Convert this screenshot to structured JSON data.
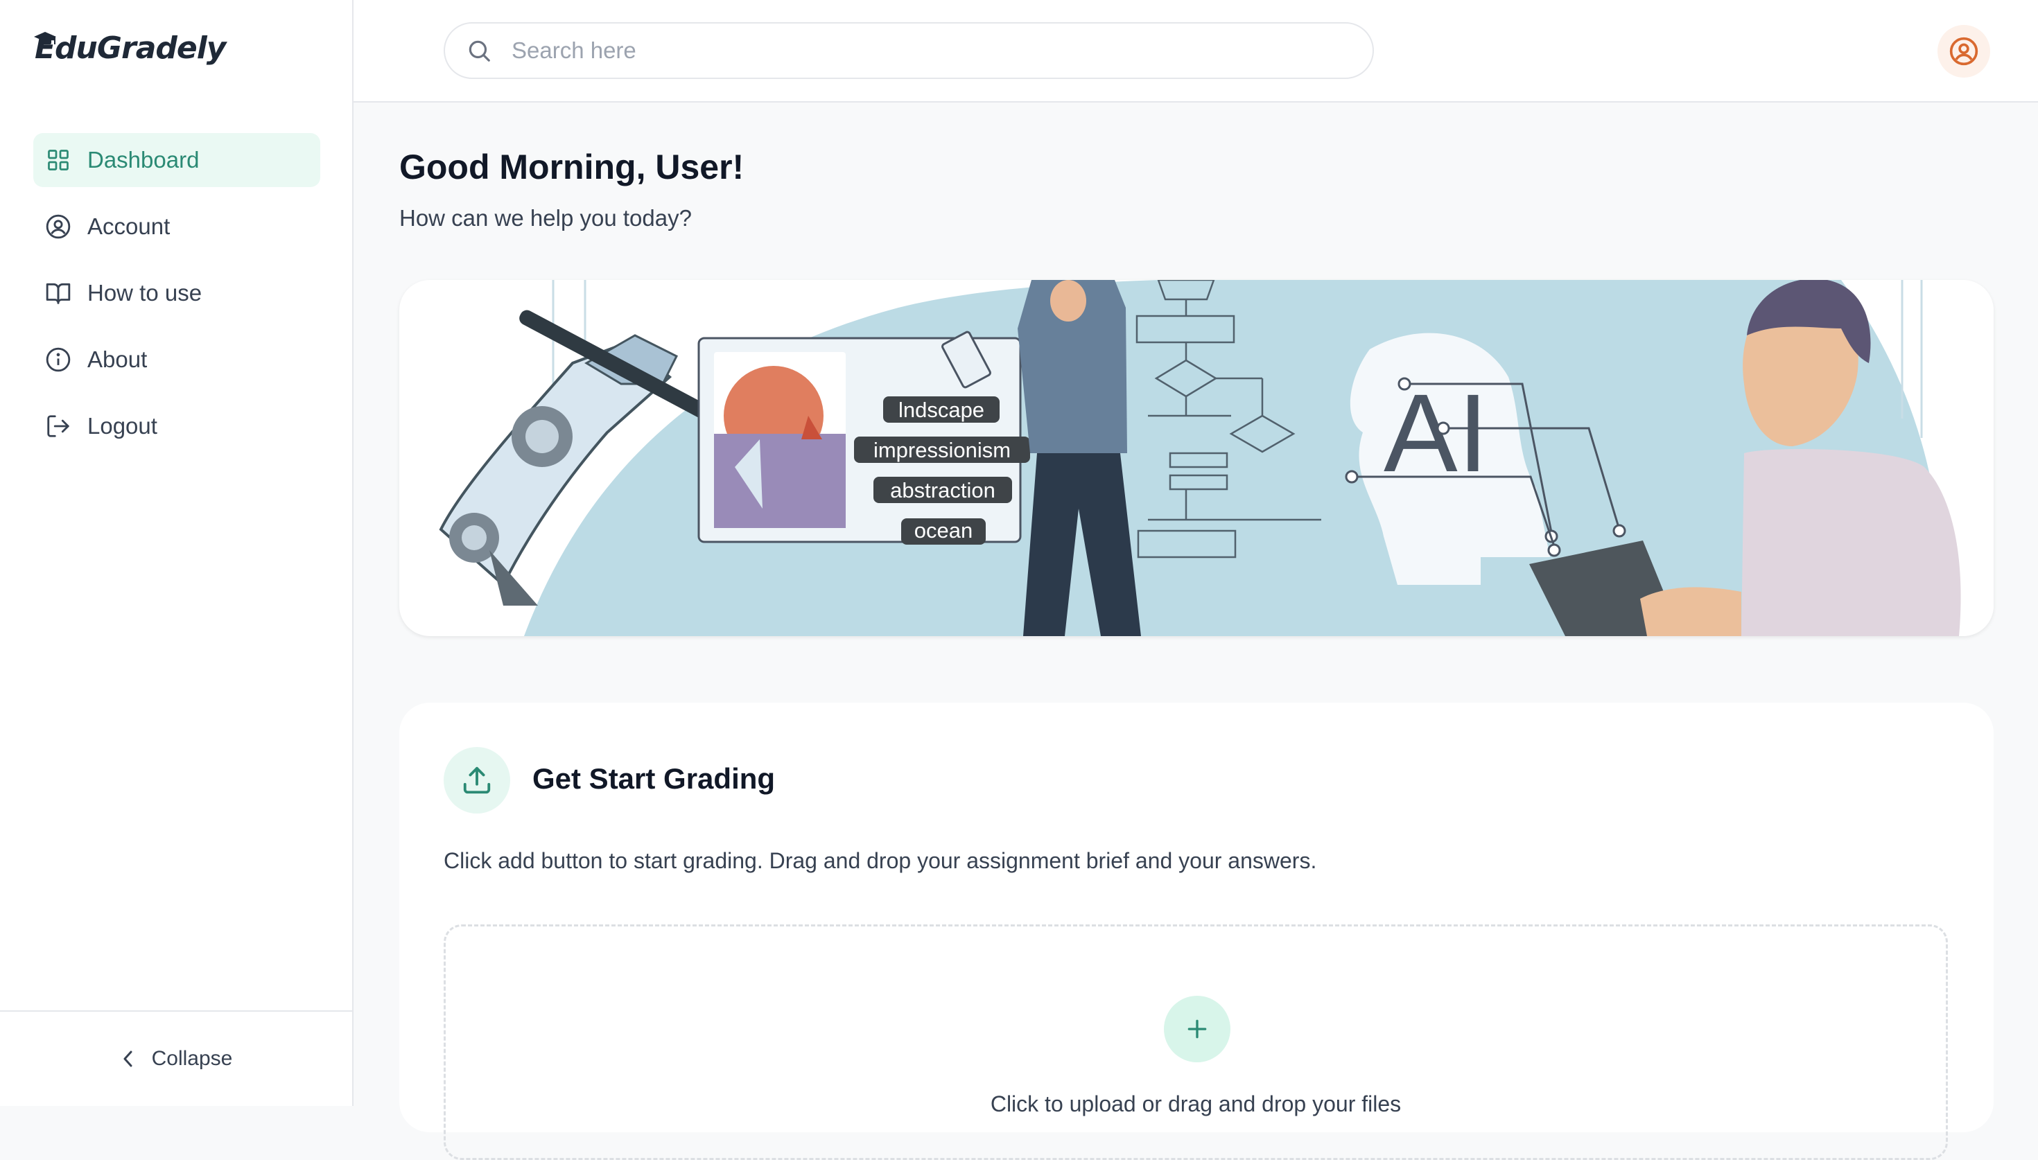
{
  "brand": {
    "name": "EduGradely"
  },
  "sidebar": {
    "items": [
      {
        "label": "Dashboard",
        "icon": "grid-icon",
        "active": true
      },
      {
        "label": "Account",
        "icon": "user-circle-icon",
        "active": false
      },
      {
        "label": "How to use",
        "icon": "book-icon",
        "active": false
      },
      {
        "label": "About",
        "icon": "info-icon",
        "active": false
      },
      {
        "label": "Logout",
        "icon": "logout-icon",
        "active": false
      }
    ],
    "collapse_label": "Collapse"
  },
  "header": {
    "search_placeholder": "Search here",
    "search_value": ""
  },
  "main": {
    "greeting": "Good Morning, User!",
    "subgreeting": "How can we help you today?",
    "banner": {
      "tags": [
        "lndscape",
        "impressionism",
        "abstraction",
        "ocean"
      ],
      "ai_text": "AI"
    },
    "grading": {
      "title": "Get Start Grading",
      "description": "Click add button to start grading. Drag and drop your assignment brief and your answers.",
      "upload_text": "Click to upload or drag and drop your files"
    }
  },
  "colors": {
    "accent": "#2b8a74",
    "accent_light": "#eaf9f3",
    "banner_blue": "#bcdbe5",
    "avatar_orange": "#d9692f"
  }
}
